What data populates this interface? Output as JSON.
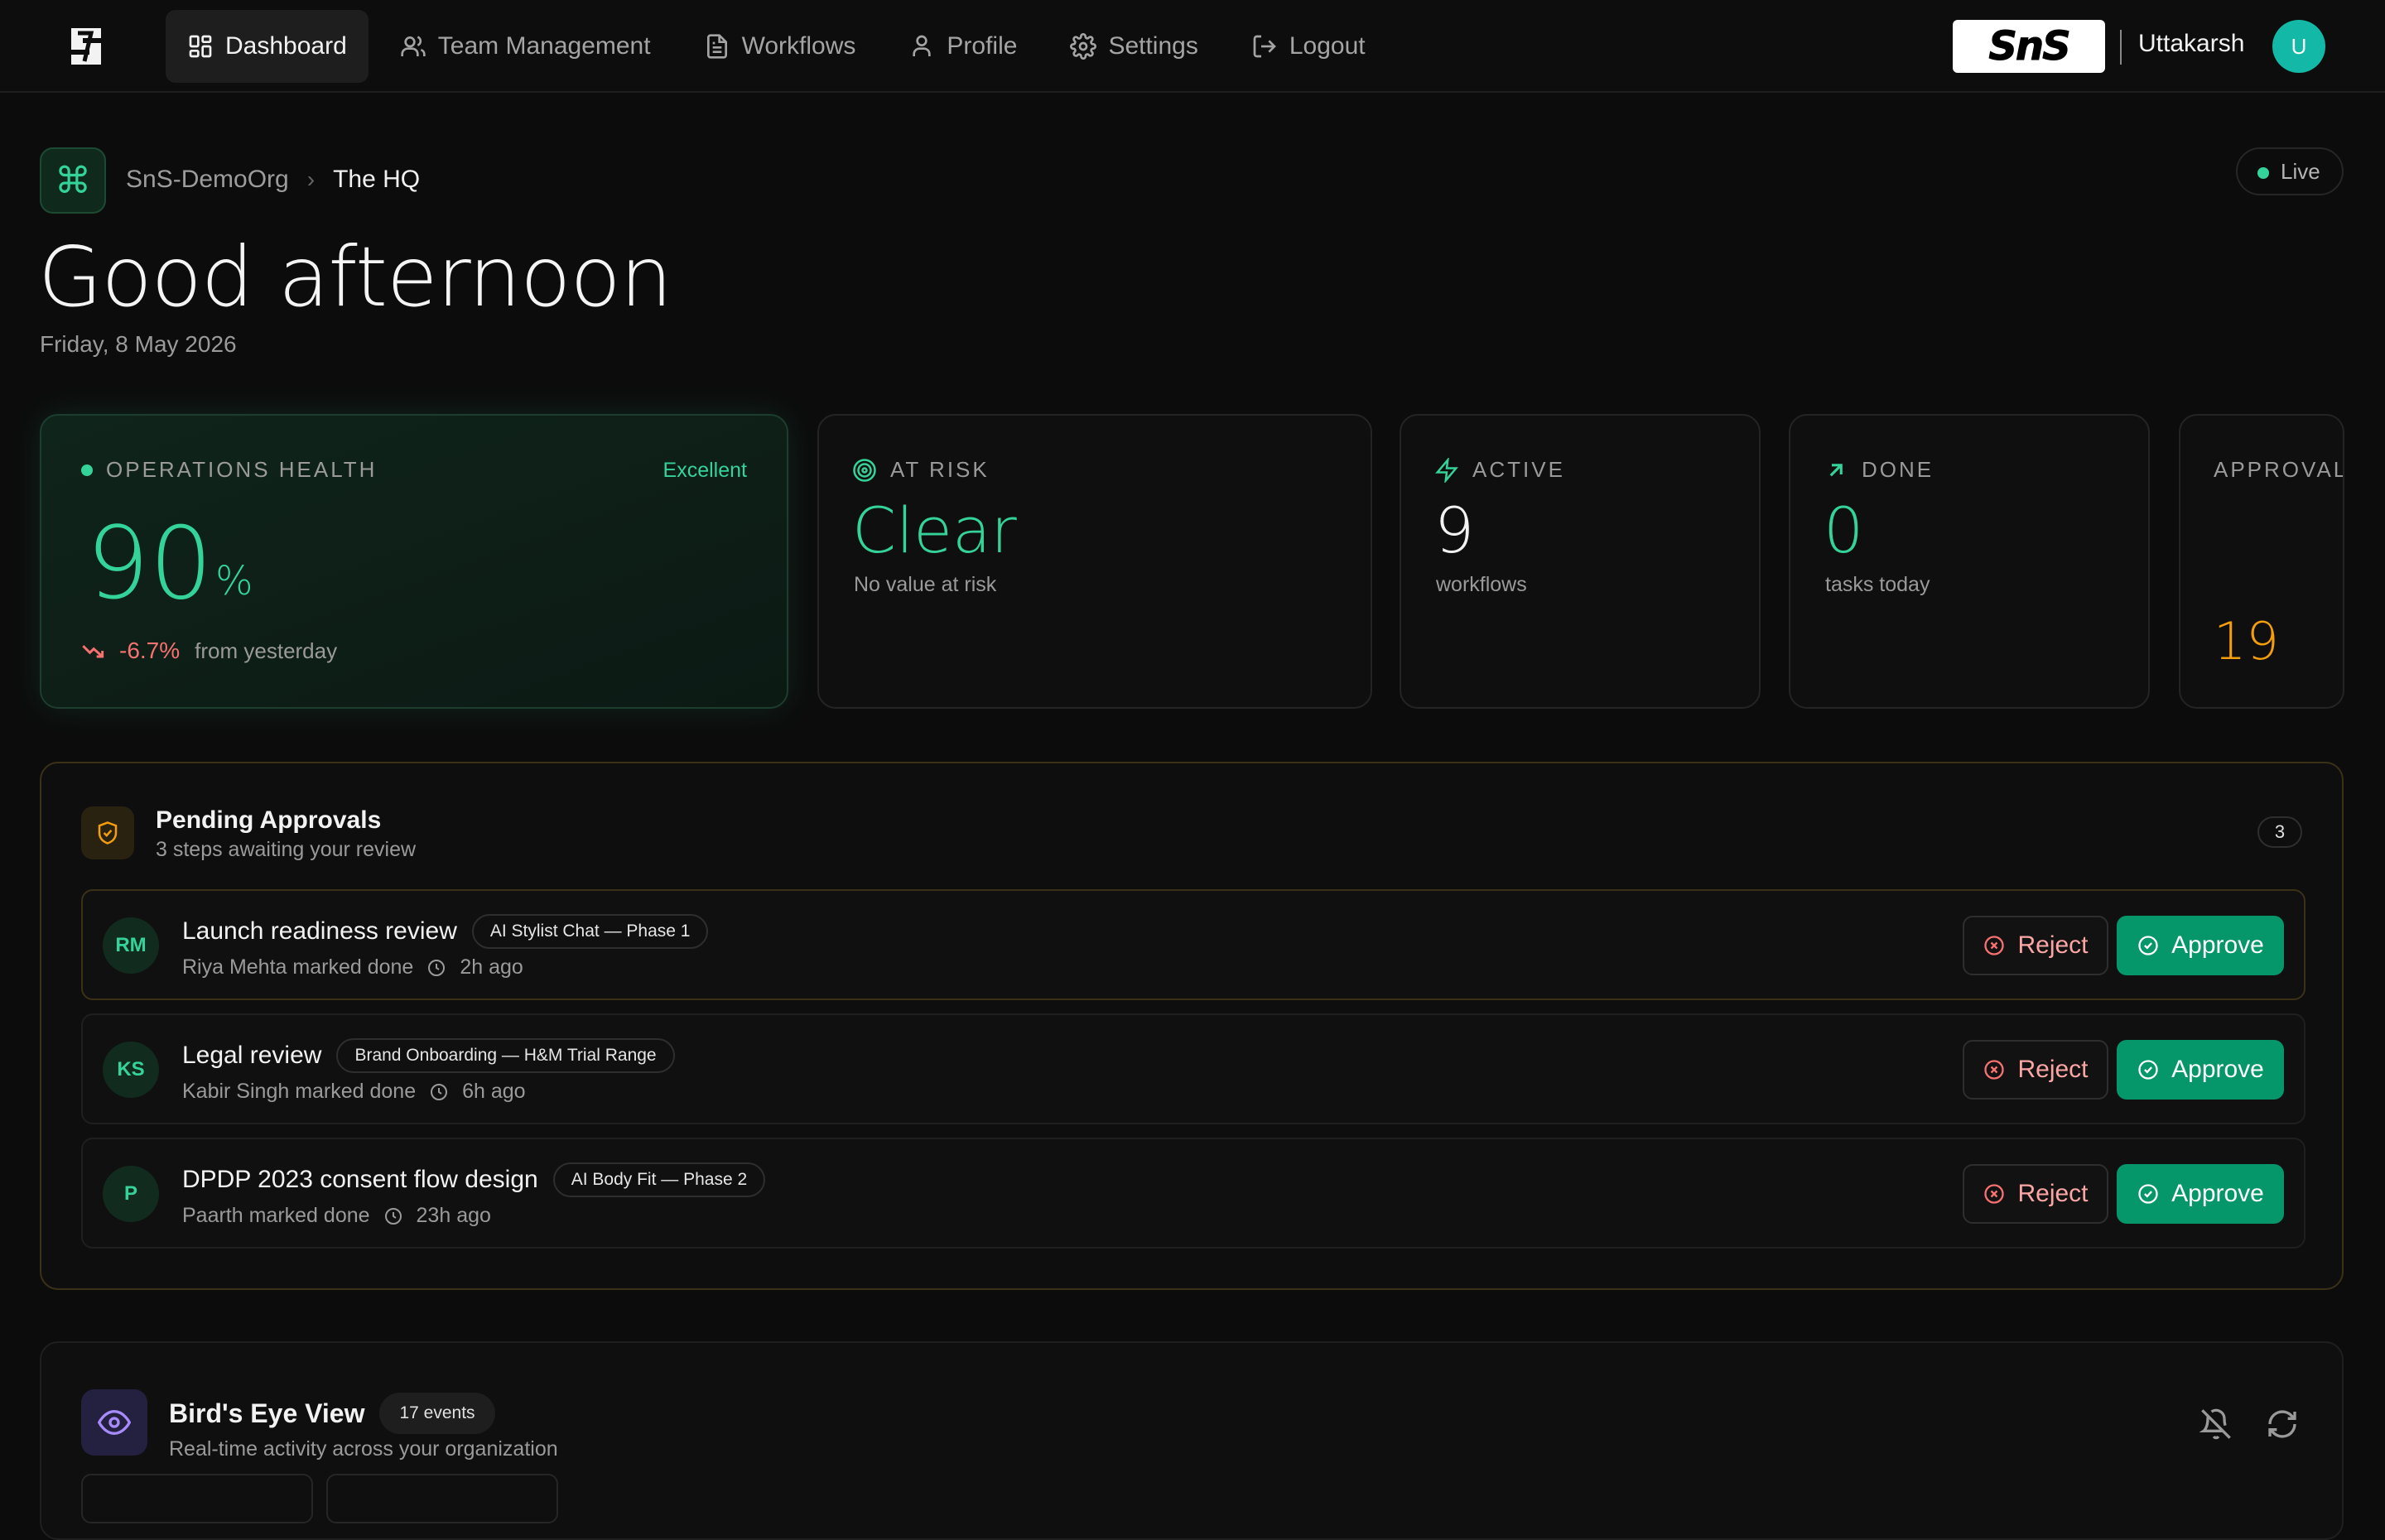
{
  "nav": {
    "items": [
      {
        "label": "Dashboard",
        "icon": "dashboard-icon",
        "active": true
      },
      {
        "label": "Team Management",
        "icon": "users-icon"
      },
      {
        "label": "Workflows",
        "icon": "document-icon"
      },
      {
        "label": "Profile",
        "icon": "user-icon"
      },
      {
        "label": "Settings",
        "icon": "gear-icon"
      },
      {
        "label": "Logout",
        "icon": "logout-icon"
      }
    ],
    "brand_text": "SnS",
    "user_name": "Uttakarsh",
    "user_initial": "U"
  },
  "header": {
    "org": "SnS-DemoOrg",
    "current": "The HQ",
    "status": "Live",
    "greeting": "Good afternoon",
    "date": "Friday, 8 May 2026"
  },
  "stats": {
    "health": {
      "label": "OPERATIONS HEALTH",
      "rating": "Excellent",
      "value": "90",
      "unit": "%",
      "trend": "-6.7%",
      "trend_text": "from yesterday"
    },
    "at_risk": {
      "label": "AT RISK",
      "value": "Clear",
      "sub": "No value at risk"
    },
    "active": {
      "label": "ACTIVE",
      "value": "9",
      "sub": "workflows"
    },
    "done": {
      "label": "DONE",
      "value": "0",
      "sub": "tasks today"
    },
    "approvals": {
      "label": "APPROVALS",
      "value": "19"
    }
  },
  "pending": {
    "title": "Pending Approvals",
    "subtitle": "3 steps awaiting your review",
    "count": "3",
    "reject_label": "Reject",
    "approve_label": "Approve",
    "items": [
      {
        "initials": "RM",
        "title": "Launch readiness review",
        "tag": "AI Stylist Chat — Phase 1",
        "meta": "Riya Mehta marked done",
        "time": "2h ago"
      },
      {
        "initials": "KS",
        "title": "Legal review",
        "tag": "Brand Onboarding — H&M Trial Range",
        "meta": "Kabir Singh marked done",
        "time": "6h ago"
      },
      {
        "initials": "P",
        "title": "DPDP 2023 consent flow design",
        "tag": "AI Body Fit — Phase 2",
        "meta": "Paarth marked done",
        "time": "23h ago"
      }
    ]
  },
  "birds_eye": {
    "title": "Bird's Eye View",
    "events": "17 events",
    "subtitle": "Real-time activity across your organization"
  },
  "colors": {
    "accent": "#34d399",
    "approve": "#059669",
    "reject": "#fca5a5",
    "warning": "#f59e0b",
    "avatar": "#14b8a6"
  }
}
